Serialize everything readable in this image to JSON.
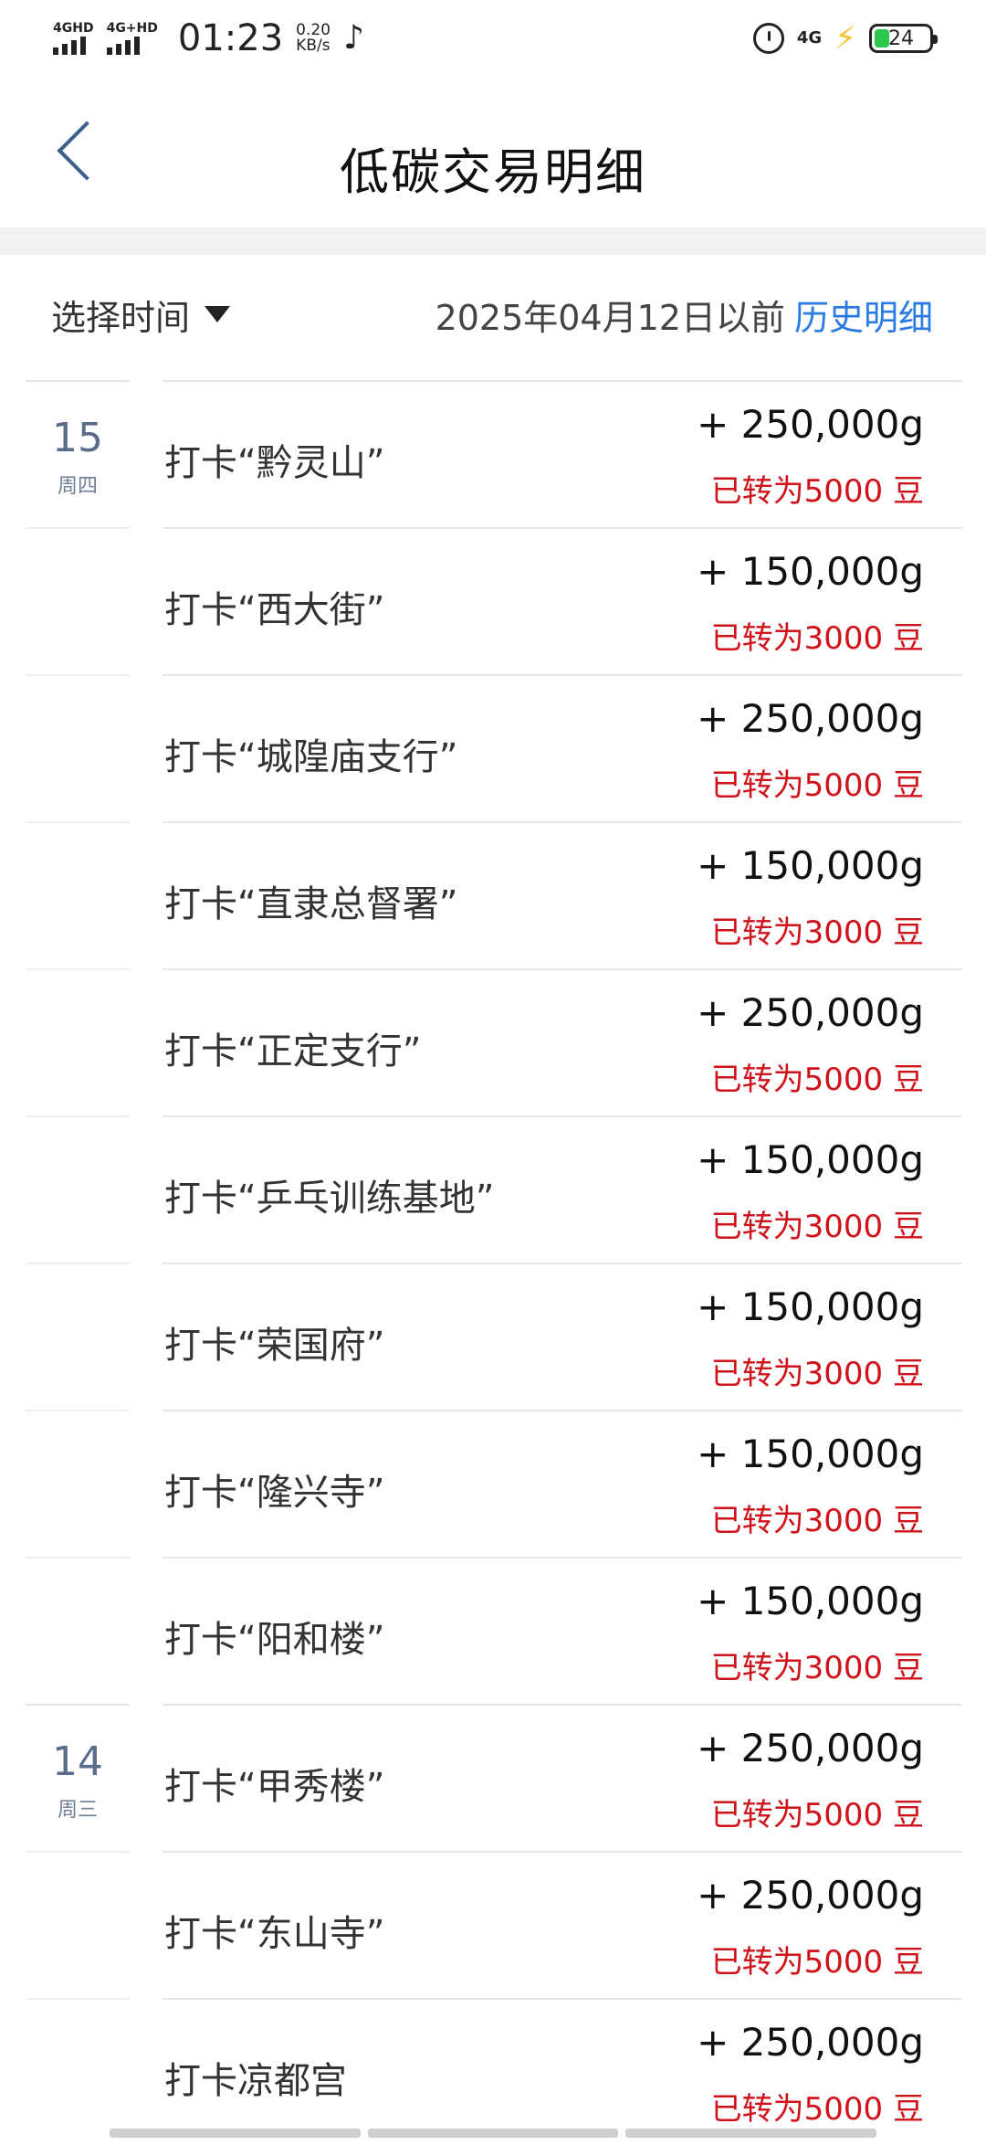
{
  "status_bar": {
    "sim1_label": "4GHD",
    "sim2_label": "4G+HD",
    "time": "01:23",
    "speed_value": "0.20",
    "speed_unit": "KB/s",
    "app_icon": "tiktok-icon",
    "alarm_icon": "alarm-icon",
    "network_label": "4G",
    "charging_icon": "bolt-icon",
    "battery_level": "24"
  },
  "header": {
    "title": "低碳交易明细",
    "back_icon": "chevron-left-icon"
  },
  "filter": {
    "select_label": "选择时间",
    "date_before": "2025年04月12日以前",
    "history_link": "历史明细"
  },
  "colors": {
    "accent": "#2b7be2",
    "bean": "#d0121b",
    "date": "#5a6c8c"
  },
  "transactions": [
    {
      "day": "15",
      "weekday": "周四",
      "title": "打卡“黔灵山”",
      "amount": "+ 250,000g",
      "bean": "已转为5000 豆"
    },
    {
      "day": "",
      "weekday": "",
      "title": "打卡“西大街”",
      "amount": "+ 150,000g",
      "bean": "已转为3000 豆"
    },
    {
      "day": "",
      "weekday": "",
      "title": "打卡“城隍庙支行”",
      "amount": "+ 250,000g",
      "bean": "已转为5000 豆"
    },
    {
      "day": "",
      "weekday": "",
      "title": "打卡“直隶总督署”",
      "amount": "+ 150,000g",
      "bean": "已转为3000 豆"
    },
    {
      "day": "",
      "weekday": "",
      "title": "打卡“正定支行”",
      "amount": "+ 250,000g",
      "bean": "已转为5000 豆"
    },
    {
      "day": "",
      "weekday": "",
      "title": "打卡“乒乓训练基地”",
      "amount": "+ 150,000g",
      "bean": "已转为3000 豆"
    },
    {
      "day": "",
      "weekday": "",
      "title": "打卡“荣国府”",
      "amount": "+ 150,000g",
      "bean": "已转为3000 豆"
    },
    {
      "day": "",
      "weekday": "",
      "title": "打卡“隆兴寺”",
      "amount": "+ 150,000g",
      "bean": "已转为3000 豆"
    },
    {
      "day": "",
      "weekday": "",
      "title": "打卡“阳和楼”",
      "amount": "+ 150,000g",
      "bean": "已转为3000 豆"
    },
    {
      "day": "14",
      "weekday": "周三",
      "title": "打卡“甲秀楼”",
      "amount": "+ 250,000g",
      "bean": "已转为5000 豆"
    },
    {
      "day": "",
      "weekday": "",
      "title": "打卡“东山寺”",
      "amount": "+ 250,000g",
      "bean": "已转为5000 豆"
    },
    {
      "day": "",
      "weekday": "",
      "title": "打卡凉都宫",
      "amount": "+ 250,000g",
      "bean": "已转为5000 豆"
    }
  ]
}
